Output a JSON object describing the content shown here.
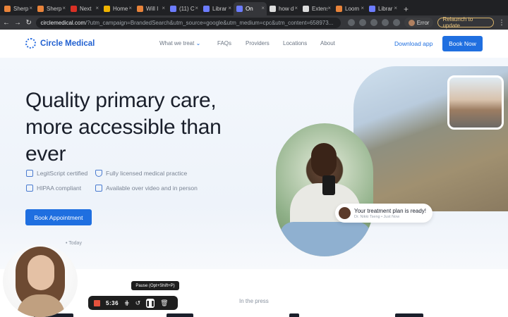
{
  "browser": {
    "tabs": [
      {
        "title": "Sherp",
        "color": "#e8833a"
      },
      {
        "title": "Sherp",
        "color": "#e8833a"
      },
      {
        "title": "Next",
        "color": "#d93025"
      },
      {
        "title": "Home",
        "color": "#f0b400"
      },
      {
        "title": "Will I",
        "color": "#e8833a"
      },
      {
        "title": "(11) Cl",
        "color": "#6c7cff"
      },
      {
        "title": "Librar",
        "color": "#6c7cff"
      },
      {
        "title": "On",
        "color": "#6c7cff"
      },
      {
        "title": "how d",
        "color": "#dcdcdc"
      },
      {
        "title": "Extens",
        "color": "#dcdcdc"
      },
      {
        "title": "Loom",
        "color": "#e8833a"
      },
      {
        "title": "Librar",
        "color": "#6c7cff"
      }
    ],
    "active_tab_index": 7,
    "new_tab_label": "+",
    "address": {
      "host": "circlemedical.com",
      "path": "/?utm_campaign=BrandedSearch&utm_source=google&utm_medium=cpc&utm_content=658973..."
    },
    "error_label": "Error",
    "relaunch_label": "Relaunch to update",
    "back": "←",
    "forward": "→",
    "reload": "↻",
    "menu": "⋮"
  },
  "site": {
    "logo_text": "Circle Medical",
    "nav": [
      {
        "label": "What we treat",
        "has_dropdown": true
      },
      {
        "label": "FAQs"
      },
      {
        "label": "Providers"
      },
      {
        "label": "Locations"
      },
      {
        "label": "About"
      }
    ],
    "dropdown_caret": "⌄",
    "download_label": "Download app",
    "book_now_label": "Book Now",
    "headline_line1": "Quality primary care,",
    "headline_line2": "more accessible than",
    "headline_line3": "ever",
    "features": [
      {
        "label": "LegitScript certified",
        "icon": "tag-icon"
      },
      {
        "label": "Fully licensed medical practice",
        "icon": "shield-icon"
      },
      {
        "label": "HIPAA compliant",
        "icon": "lock-icon"
      },
      {
        "label": "Available over video and in person",
        "icon": "person-icon"
      }
    ],
    "book_appointment_label": "Book Appointment",
    "today_label": "• Today",
    "in_press_label": "In the press",
    "notice": {
      "title": "Your treatment plan is ready!",
      "subtitle": "Dr. Nikki Tseng  •  Just Now"
    }
  },
  "recorder": {
    "tooltip": "Pause (Opt+Shift+P)",
    "time": "5:36"
  },
  "colors": {
    "brand_blue": "#1f6fe0",
    "record_red": "#e5523d"
  }
}
